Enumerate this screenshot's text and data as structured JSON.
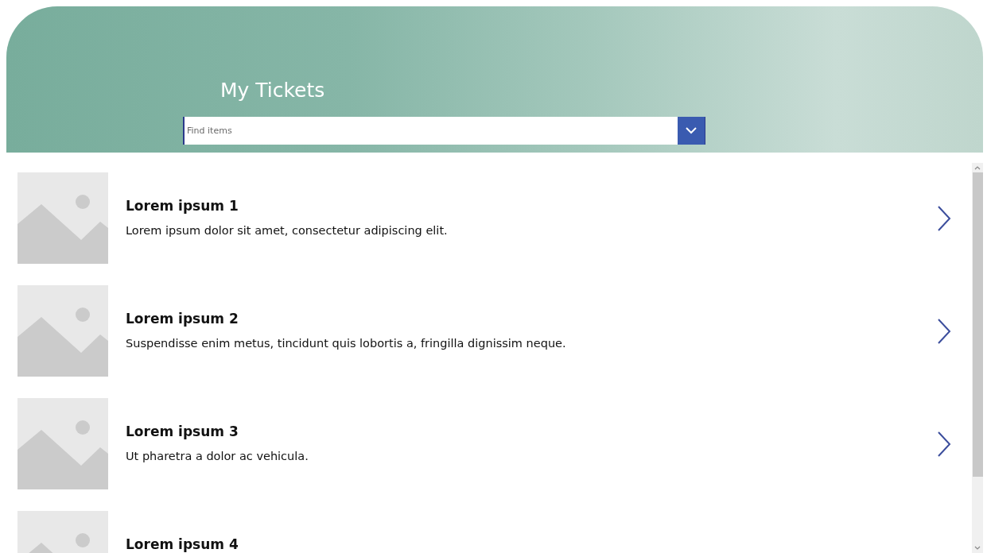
{
  "header": {
    "title": "My Tickets"
  },
  "search": {
    "placeholder": "Find items"
  },
  "items": [
    {
      "title": "Lorem ipsum 1",
      "description": "Lorem ipsum dolor sit amet, consectetur adipiscing elit."
    },
    {
      "title": "Lorem ipsum 2",
      "description": "Suspendisse enim metus, tincidunt quis lobortis a, fringilla dignissim neque."
    },
    {
      "title": "Lorem ipsum 3",
      "description": "Ut pharetra a dolor ac vehicula."
    },
    {
      "title": "Lorem ipsum 4"
    }
  ]
}
